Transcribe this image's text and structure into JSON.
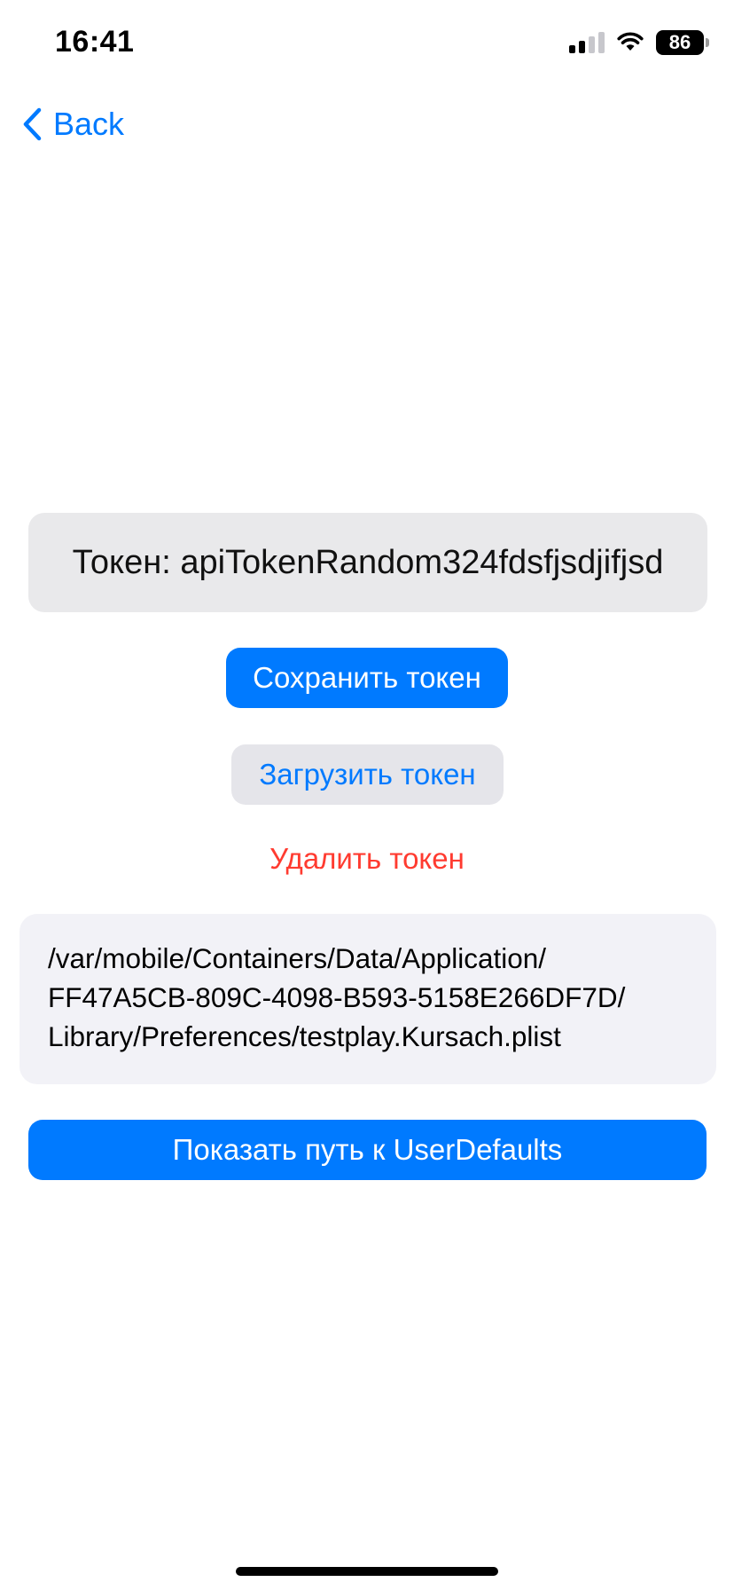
{
  "status_bar": {
    "time": "16:41",
    "battery": "86",
    "icons": [
      "cellular-signal-icon",
      "wifi-icon",
      "battery-icon"
    ]
  },
  "nav": {
    "back_label": "Back",
    "back_icon": "chevron-left-icon"
  },
  "token": {
    "display_text": "Токен: apiTokenRandom324fdsfjsdjifjsd"
  },
  "actions": {
    "save_label": "Сохранить токен",
    "load_label": "Загрузить токен",
    "delete_label": "Удалить токен"
  },
  "user_defaults": {
    "path_lines": [
      "/var/mobile/Containers/Data/Application/",
      "FF47A5CB-809C-4098-B593-5158E266DF7D/",
      "Library/Preferences/testplay.Kursach.plist"
    ],
    "show_path_label": "Показать путь к UserDefaults"
  },
  "colors": {
    "accent": "#007aff",
    "destructive": "#ff3b30",
    "field_background": "#e9e9eb",
    "secondary_button_background": "#e5e5ea",
    "path_background": "#f2f2f7"
  }
}
